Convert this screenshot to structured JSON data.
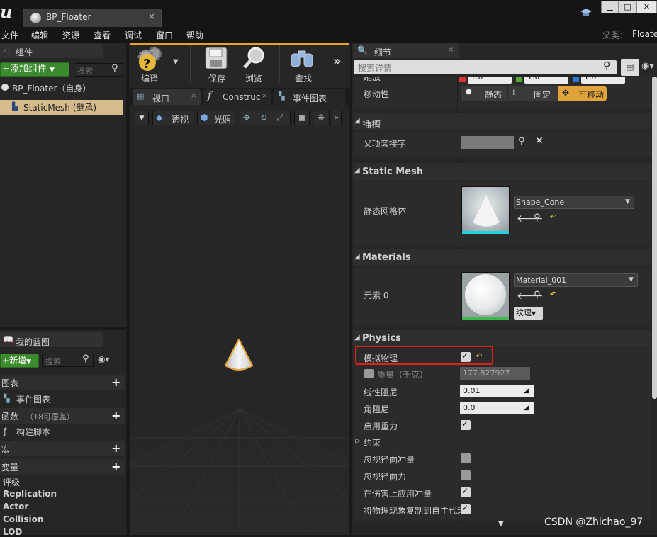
{
  "window": {
    "tab_title": "BP_Floater",
    "tab_close": "×",
    "min": "▁",
    "max": "□",
    "close": "✕"
  },
  "menu": [
    "文件",
    "编辑",
    "资源",
    "查看",
    "调试",
    "窗口",
    "帮助"
  ],
  "parent": {
    "label": "父类：",
    "value": "Floate"
  },
  "components": {
    "title": "组件",
    "add_button": "+添加组件",
    "search_placeholder": "搜索",
    "root_item": "BP_Floater（自身）",
    "child_item": "StaticMesh (继承)"
  },
  "toolbar": {
    "compile": "编译",
    "save": "保存",
    "browse": "浏览",
    "find": "查找"
  },
  "editor_tabs": {
    "viewport": "视口",
    "construct": "Construc",
    "event_graph": "事件图表"
  },
  "viewport_bar": {
    "perspective": "透视",
    "lit": "光照"
  },
  "my_blueprint": {
    "title": "我的蓝图",
    "new_button": "新增",
    "search_placeholder": "搜索",
    "graphs": "图表",
    "event_graph": "事件图表",
    "functions": "函数",
    "functions_note": "（18可覆盖）",
    "construction_script": "构建脚本",
    "macros": "宏",
    "variables": "变量",
    "categories": [
      "评级",
      "Replication",
      "Actor",
      "Collision",
      "LOD"
    ]
  },
  "details": {
    "title": "细节",
    "search_placeholder": "搜索详情",
    "scale_label": "缩放",
    "scale_values": [
      "1.0",
      "1.0",
      "1.0"
    ],
    "mobility_label": "移动性",
    "mobility_options": [
      "静态",
      "固定",
      "可移动"
    ],
    "mobility_selected": "可移动",
    "socket_section": "插槽",
    "parent_socket_label": "父项套接字",
    "static_mesh_section": "Static Mesh",
    "static_mesh_label": "静态网格体",
    "static_mesh_value": "Shape_Cone",
    "materials_section": "Materials",
    "element_label": "元素 0",
    "material_value": "Material_001",
    "texture_button": "纹理",
    "physics_section": "Physics",
    "simulate_physics": "模拟物理",
    "mass_label": "质量（千克）",
    "mass_value": "177.827927",
    "linear_damping_label": "线性阻尼",
    "linear_damping_value": "0.01",
    "angular_damping_label": "角阻尼",
    "angular_damping_value": "0.0",
    "enable_gravity_label": "启用重力",
    "constraints_label": "约束",
    "ignore_radial_impulse": "忽视径向冲量",
    "ignore_radial_force": "忽视径向力",
    "apply_impulse_on_damage": "在伤害上应用冲量",
    "replicate_physics": "将物理现象复制到自主代理"
  },
  "watermark": "CSDN @Zhichao_97",
  "colors": {
    "highlight_border": "#e0201a",
    "movable_orange": "#e0a43a",
    "green_button": "#3b8b2e"
  }
}
